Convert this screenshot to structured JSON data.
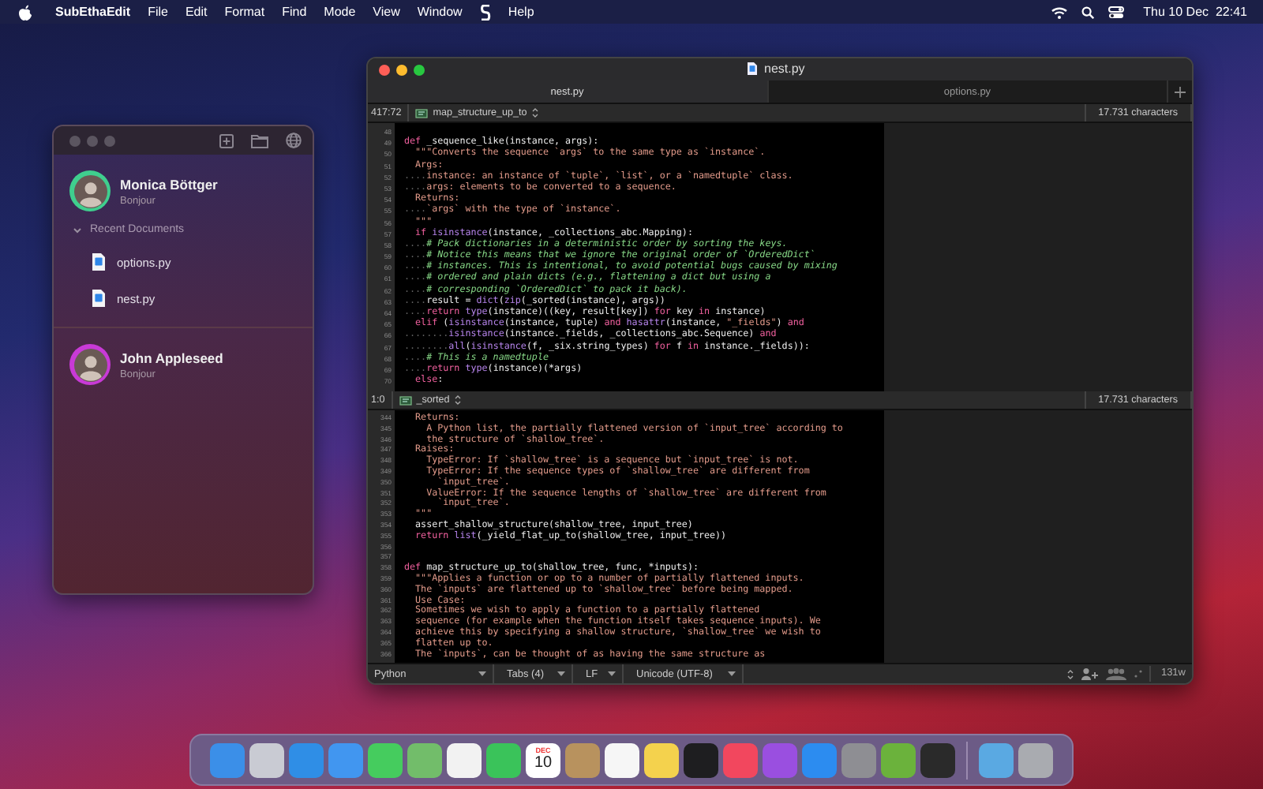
{
  "menu_bar": {
    "app_name": "SubEthaEdit",
    "menus": [
      {
        "kind": "text",
        "label": "File"
      },
      {
        "kind": "text",
        "label": "Edit"
      },
      {
        "kind": "text",
        "label": "Format"
      },
      {
        "kind": "text",
        "label": "Find"
      },
      {
        "kind": "text",
        "label": "Mode"
      },
      {
        "kind": "text",
        "label": "View"
      },
      {
        "kind": "text",
        "label": "Window"
      },
      {
        "kind": "script"
      },
      {
        "kind": "text",
        "label": "Help"
      }
    ],
    "clock": "Thu 10 Dec  22:41"
  },
  "contacts_window": {
    "users": [
      {
        "name": "Monica Böttger",
        "status": "Bonjour",
        "color": "#3fcf8e",
        "recent_documents": {
          "label": "Recent Documents",
          "expanded": true,
          "items": [
            "options.py",
            "nest.py"
          ]
        }
      },
      {
        "name": "John Appleseed",
        "status": "Bonjour",
        "color": "#c83ad6"
      }
    ]
  },
  "editor": {
    "title": "nest.py",
    "tabs": [
      {
        "label": "nest.py",
        "selected": true
      },
      {
        "label": "options.py",
        "selected": false
      }
    ],
    "panes": [
      {
        "position": "417:72",
        "symbol": "map_structure_up_to",
        "char_count": "17.731 characters",
        "lines": [
          {
            "num": "48"
          },
          {
            "num": "49",
            "segments": [
              {
                "kind": "kw",
                "text": "def"
              },
              {
                "kind": "id",
                "text": " _sequence_like(instance, args):"
              }
            ]
          },
          {
            "num": "50",
            "segments": [
              {
                "kind": "doc",
                "text": "  \"\"\"Converts the sequence `args` to the same type as `instance`."
              }
            ]
          },
          {
            "num": "51",
            "segments": [
              {
                "kind": "doc",
                "text": "  Args:"
              }
            ]
          },
          {
            "num": "52",
            "segments": [
              {
                "kind": "ws",
                "text": "...."
              },
              {
                "kind": "doc",
                "text": "instance: an instance of `tuple`, `list`, or a `namedtuple` class."
              }
            ]
          },
          {
            "num": "53",
            "segments": [
              {
                "kind": "ws",
                "text": "...."
              },
              {
                "kind": "doc",
                "text": "args: elements to be converted to a sequence."
              }
            ]
          },
          {
            "num": "54",
            "segments": [
              {
                "kind": "doc",
                "text": "  Returns:"
              }
            ]
          },
          {
            "num": "55",
            "segments": [
              {
                "kind": "ws",
                "text": "...."
              },
              {
                "kind": "doc",
                "text": "`args` with the type of `instance`."
              }
            ]
          },
          {
            "num": "56",
            "segments": [
              {
                "kind": "doc",
                "text": "  \"\"\""
              }
            ]
          },
          {
            "num": "57",
            "segments": [
              {
                "kind": "kw",
                "text": "  if"
              },
              {
                "kind": "fn",
                "text": " isinstance"
              },
              {
                "kind": "id",
                "text": "(instance, _collections_abc.Mapping):"
              }
            ]
          },
          {
            "num": "58",
            "segments": [
              {
                "kind": "ws",
                "text": "...."
              },
              {
                "kind": "cm",
                "text": "# Pack dictionaries in a deterministic order by sorting the keys."
              }
            ]
          },
          {
            "num": "59",
            "segments": [
              {
                "kind": "ws",
                "text": "...."
              },
              {
                "kind": "cm",
                "text": "# Notice this means that we ignore the original order of `OrderedDict`"
              }
            ]
          },
          {
            "num": "60",
            "segments": [
              {
                "kind": "ws",
                "text": "...."
              },
              {
                "kind": "cm",
                "text": "# instances. This is intentional, to avoid potential bugs caused by mixing"
              }
            ]
          },
          {
            "num": "61",
            "segments": [
              {
                "kind": "ws",
                "text": "...."
              },
              {
                "kind": "cm",
                "text": "# ordered and plain dicts (e.g., flattening a dict but using a"
              }
            ]
          },
          {
            "num": "62",
            "segments": [
              {
                "kind": "ws",
                "text": "...."
              },
              {
                "kind": "cm",
                "text": "# corresponding `OrderedDict` to pack it back)."
              }
            ]
          },
          {
            "num": "63",
            "segments": [
              {
                "kind": "ws",
                "text": "...."
              },
              {
                "kind": "id",
                "text": "result = "
              },
              {
                "kind": "fn",
                "text": "dict"
              },
              {
                "kind": "id",
                "text": "("
              },
              {
                "kind": "fn",
                "text": "zip"
              },
              {
                "kind": "id",
                "text": "(_sorted(instance), args))"
              }
            ]
          },
          {
            "num": "64",
            "segments": [
              {
                "kind": "ws",
                "text": "...."
              },
              {
                "kind": "kw",
                "text": "return"
              },
              {
                "kind": "fn",
                "text": " type"
              },
              {
                "kind": "id",
                "text": "(instance)((key, result[key]) "
              },
              {
                "kind": "kw",
                "text": "for"
              },
              {
                "kind": "id",
                "text": " key "
              },
              {
                "kind": "kw",
                "text": "in"
              },
              {
                "kind": "id",
                "text": " instance)"
              }
            ]
          },
          {
            "num": "65",
            "segments": [
              {
                "kind": "kw",
                "text": "  elif"
              },
              {
                "kind": "id",
                "text": " ("
              },
              {
                "kind": "fn",
                "text": "isinstance"
              },
              {
                "kind": "id",
                "text": "(instance, tuple) "
              },
              {
                "kind": "kw",
                "text": "and"
              },
              {
                "kind": "fn",
                "text": " hasattr"
              },
              {
                "kind": "id",
                "text": "(instance, "
              },
              {
                "kind": "str",
                "text": "\"_fields\""
              },
              {
                "kind": "id",
                "text": ") "
              },
              {
                "kind": "kw",
                "text": "and"
              }
            ]
          },
          {
            "num": "66",
            "segments": [
              {
                "kind": "ws",
                "text": "........"
              },
              {
                "kind": "fn",
                "text": "isinstance"
              },
              {
                "kind": "id",
                "text": "(instance._fields, _collections_abc.Sequence) "
              },
              {
                "kind": "kw",
                "text": "and"
              }
            ]
          },
          {
            "num": "67",
            "segments": [
              {
                "kind": "ws",
                "text": "........"
              },
              {
                "kind": "fn",
                "text": "all"
              },
              {
                "kind": "id",
                "text": "("
              },
              {
                "kind": "fn",
                "text": "isinstance"
              },
              {
                "kind": "id",
                "text": "(f, _six.string_types) "
              },
              {
                "kind": "kw",
                "text": "for"
              },
              {
                "kind": "id",
                "text": " f "
              },
              {
                "kind": "kw",
                "text": "in"
              },
              {
                "kind": "id",
                "text": " instance._fields)):"
              }
            ]
          },
          {
            "num": "68",
            "segments": [
              {
                "kind": "ws",
                "text": "...."
              },
              {
                "kind": "cm",
                "text": "# This is a namedtuple"
              }
            ]
          },
          {
            "num": "69",
            "segments": [
              {
                "kind": "ws",
                "text": "...."
              },
              {
                "kind": "kw",
                "text": "return"
              },
              {
                "kind": "fn",
                "text": " type"
              },
              {
                "kind": "id",
                "text": "(instance)(*args)"
              }
            ]
          },
          {
            "num": "70",
            "segments": [
              {
                "kind": "kw",
                "text": "  else"
              },
              {
                "kind": "id",
                "text": ":"
              }
            ]
          }
        ]
      },
      {
        "position": "1:0",
        "symbol": "_sorted",
        "char_count": "17.731 characters",
        "lines": [
          {
            "num": "344",
            "segments": [
              {
                "kind": "doc",
                "text": "  Returns:"
              }
            ]
          },
          {
            "num": "345",
            "segments": [
              {
                "kind": "doc",
                "text": "    A Python list, the partially flattened version of `input_tree` according to"
              }
            ]
          },
          {
            "num": "346",
            "segments": [
              {
                "kind": "doc",
                "text": "    the structure of `shallow_tree`."
              }
            ]
          },
          {
            "num": "347",
            "segments": [
              {
                "kind": "doc",
                "text": "  Raises:"
              }
            ]
          },
          {
            "num": "348",
            "segments": [
              {
                "kind": "doc",
                "text": "    TypeError: If `shallow_tree` is a sequence but `input_tree` is not."
              }
            ]
          },
          {
            "num": "349",
            "segments": [
              {
                "kind": "doc",
                "text": "    TypeError: If the sequence types of `shallow_tree` are different from"
              }
            ]
          },
          {
            "num": "350",
            "segments": [
              {
                "kind": "doc",
                "text": "      `input_tree`."
              }
            ]
          },
          {
            "num": "351",
            "segments": [
              {
                "kind": "doc",
                "text": "    ValueError: If the sequence lengths of `shallow_tree` are different from"
              }
            ]
          },
          {
            "num": "352",
            "segments": [
              {
                "kind": "doc",
                "text": "      `input_tree`."
              }
            ]
          },
          {
            "num": "353",
            "segments": [
              {
                "kind": "doc",
                "text": "  \"\"\""
              }
            ]
          },
          {
            "num": "354",
            "segments": [
              {
                "kind": "id",
                "text": "  assert_shallow_structure(shallow_tree, input_tree)"
              }
            ]
          },
          {
            "num": "355",
            "segments": [
              {
                "kind": "kw",
                "text": "  return"
              },
              {
                "kind": "fn",
                "text": " list"
              },
              {
                "kind": "id",
                "text": "(_yield_flat_up_to(shallow_tree, input_tree))"
              }
            ]
          },
          {
            "num": "356"
          },
          {
            "num": "357"
          },
          {
            "num": "358",
            "segments": [
              {
                "kind": "kw",
                "text": "def"
              },
              {
                "kind": "id",
                "text": " map_structure_up_to(shallow_tree, func, *inputs):"
              }
            ]
          },
          {
            "num": "359",
            "segments": [
              {
                "kind": "doc",
                "text": "  \"\"\"Applies a function or op to a number of partially flattened inputs."
              }
            ]
          },
          {
            "num": "360",
            "segments": [
              {
                "kind": "doc",
                "text": "  The `inputs` are flattened up to `shallow_tree` before being mapped."
              }
            ]
          },
          {
            "num": "361",
            "segments": [
              {
                "kind": "doc",
                "text": "  Use Case:"
              }
            ]
          },
          {
            "num": "362",
            "segments": [
              {
                "kind": "doc",
                "text": "  Sometimes we wish to apply a function to a partially flattened"
              }
            ]
          },
          {
            "num": "363",
            "segments": [
              {
                "kind": "doc",
                "text": "  sequence (for example when the function itself takes sequence inputs). We"
              }
            ]
          },
          {
            "num": "364",
            "segments": [
              {
                "kind": "doc",
                "text": "  achieve this by specifying a shallow structure, `shallow_tree` we wish to"
              }
            ]
          },
          {
            "num": "365",
            "segments": [
              {
                "kind": "doc",
                "text": "  flatten up to."
              }
            ]
          },
          {
            "num": "366",
            "segments": [
              {
                "kind": "doc",
                "text": "  The `inputs`, can be thought of as having the same structure as"
              }
            ]
          }
        ]
      }
    ],
    "status_bar": {
      "mode": "Python",
      "indentation": "Tabs (4)",
      "line_endings": "LF",
      "encoding": "Unicode (UTF-8)",
      "width": "131w"
    }
  },
  "dock": {
    "apps": [
      {
        "kind": "app",
        "color": "#3b8fe8"
      },
      {
        "kind": "app",
        "color": "#c9cbd3"
      },
      {
        "kind": "app",
        "color": "#2f8ee6"
      },
      {
        "kind": "app",
        "color": "#4196f0"
      },
      {
        "kind": "app",
        "color": "#45cc5e"
      },
      {
        "kind": "app",
        "color": "#72bd6a"
      },
      {
        "kind": "app",
        "color": "#f2f2f2"
      },
      {
        "kind": "app",
        "color": "#3ac35a"
      },
      {
        "kind": "calendar",
        "color": "#ffffff",
        "month": "DEC",
        "day": "10"
      },
      {
        "kind": "app",
        "color": "#b8925e"
      },
      {
        "kind": "app",
        "color": "#f6f6f6"
      },
      {
        "kind": "app",
        "color": "#f4d24d"
      },
      {
        "kind": "app",
        "color": "#1e1e20"
      },
      {
        "kind": "app",
        "color": "#f2475e"
      },
      {
        "kind": "app",
        "color": "#9a4fe0"
      },
      {
        "kind": "app",
        "color": "#2c8cf0"
      },
      {
        "kind": "app",
        "color": "#8e8e93"
      },
      {
        "kind": "app",
        "color": "#6bb23c"
      },
      {
        "kind": "app",
        "color": "#2a2a2a"
      },
      {
        "kind": "separator"
      },
      {
        "kind": "app",
        "color": "#5aa9e2"
      },
      {
        "kind": "app",
        "color": "#a9abb0"
      }
    ]
  }
}
